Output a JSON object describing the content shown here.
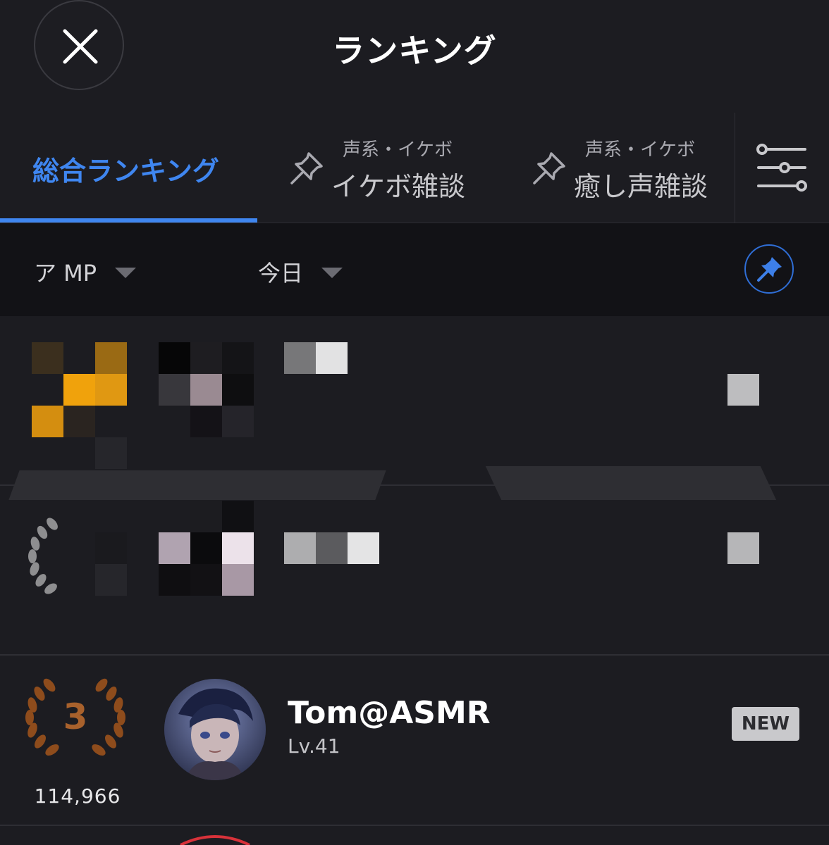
{
  "header": {
    "title": "ランキング",
    "close_icon": "close-icon"
  },
  "tabs": {
    "main": {
      "label": "総合ランキング",
      "active": true,
      "color": "#3f86f0"
    },
    "pinned": [
      {
        "category": "声系・イケボ",
        "label": "イケボ雑談",
        "icon": "pin-icon"
      },
      {
        "category": "声系・イケボ",
        "label": "癒し声雑談",
        "icon": "pin-icon"
      }
    ],
    "filter_icon": "sliders-icon"
  },
  "filters": {
    "type": "ア MP",
    "period": "今日",
    "pin_icon": "pin-icon"
  },
  "ranking": [
    {
      "rank": "3",
      "score": "114,966",
      "name": "Tom@ASMR",
      "level": "Lv.41",
      "badge": "NEW"
    }
  ],
  "colors": {
    "background": "#1c1c21",
    "accent": "#3f86f0",
    "bronze": "#a8612c"
  }
}
